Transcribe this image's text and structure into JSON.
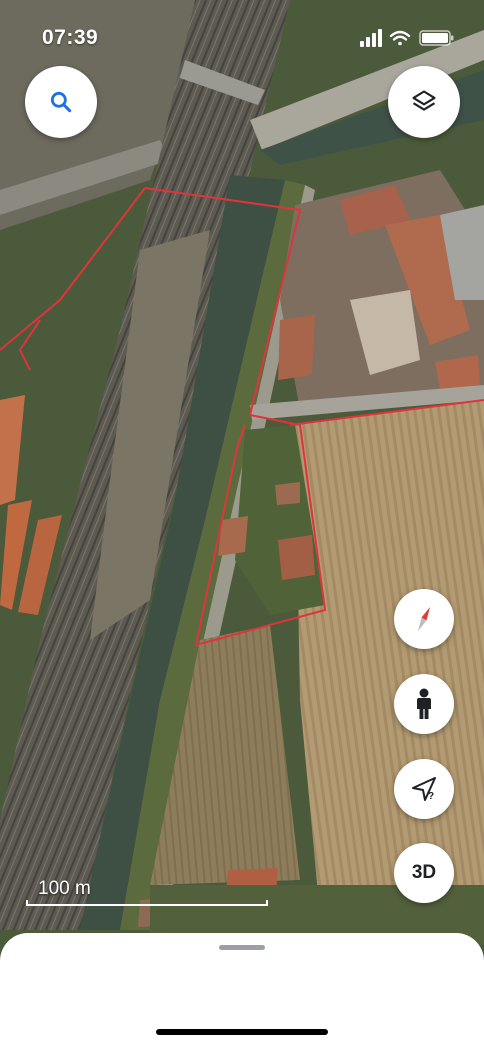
{
  "status_bar": {
    "time": "07:39"
  },
  "map": {
    "type": "satellite",
    "scale_label": "100 m",
    "boundary_color": "#e0343c"
  },
  "controls": {
    "search_icon": "search-icon",
    "layers_icon": "layers-icon",
    "compass_icon": "compass-icon",
    "street_view_icon": "pegman-icon",
    "location_icon": "location-arrow-icon",
    "view_3d_label": "3D"
  },
  "colors": {
    "accent": "#1a73e8",
    "compass_red": "#e53935"
  }
}
